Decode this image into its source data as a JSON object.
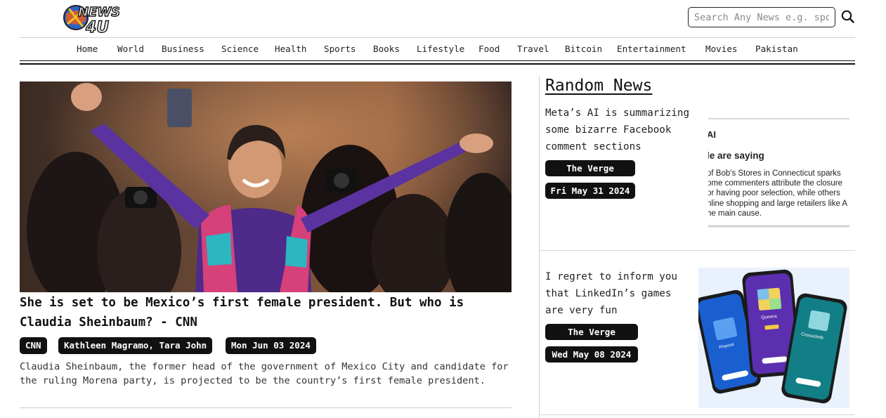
{
  "header": {
    "logo_text_top": "NEWS",
    "logo_text_bottom": "4U",
    "search_placeholder": "Search Any News e.g. sports"
  },
  "nav": {
    "items": [
      "Home",
      "World",
      "Business",
      "Science",
      "Health",
      "Sports",
      "Books",
      "Lifestyle",
      "Food",
      "Travel",
      "Bitcoin",
      "Entertainment",
      "Movies",
      "Pakistan"
    ]
  },
  "main_article": {
    "headline": "She is set to be Mexico’s first female president. But who is Claudia Sheinbaum? - CNN",
    "source": "CNN",
    "authors": "Kathleen Magramo, Tara John",
    "date": "Mon Jun 03 2024",
    "description": "Claudia Sheinbaum, the former head of the government of Mexico City and candidate for the ruling Morena party, is projected to be the country’s first female president."
  },
  "sidebar": {
    "title": "Random News",
    "items": [
      {
        "title": "Meta’s AI is summarizing some bizarre Facebook comment sections",
        "source": "The Verge",
        "date": "Fri May 31 2024",
        "thumb_lines": [
          "AI",
          "le are saying",
          "of Bob's Stores in Connecticut sparks",
          "ome commenters attribute the closure",
          "or having poor selection, while others",
          "nline shopping and large retailers like A",
          "he main cause."
        ]
      },
      {
        "title": "I regret to inform you that LinkedIn’s games are very fun",
        "source": "The Verge",
        "date": "Wed May 08 2024",
        "phone_labels": [
          "Pinpoint",
          "Queens",
          "Crossclimb"
        ]
      }
    ]
  },
  "colors": {
    "pill_bg": "#111111",
    "pill_text": "#ffffff",
    "accent_purple": "#5b2fb0",
    "phone_blue": "#1a5fd0",
    "phone_teal": "#127e85"
  }
}
